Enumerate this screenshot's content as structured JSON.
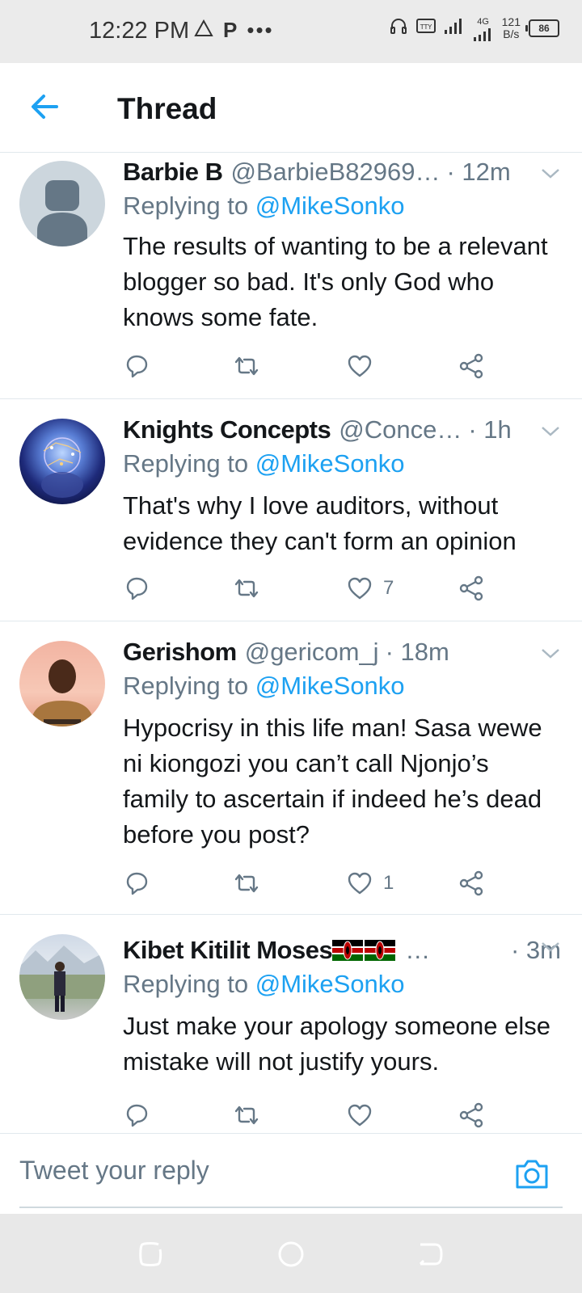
{
  "status_bar": {
    "time": "12:22 PM",
    "network_speed": "121",
    "network_speed_unit": "B/s",
    "signal_label": "4G",
    "battery": "86"
  },
  "header": {
    "title": "Thread"
  },
  "tweets": [
    {
      "name": "Barbie B",
      "handle": "@BarbieB82969…",
      "time": "· 12m",
      "replying_prefix": "Replying to",
      "mention": "@MikeSonko",
      "text": "The results of wanting to be a relevant blogger so bad. It's only God who knows some fate.",
      "likes": ""
    },
    {
      "name": "Knights Concepts",
      "handle": "@Conce…",
      "time": "· 1h",
      "replying_prefix": "Replying to",
      "mention": "@MikeSonko",
      "text": "That's why I love auditors, without evidence they can't form an opinion",
      "likes": "7"
    },
    {
      "name": "Gerishom",
      "handle": "@gericom_j",
      "time": "· 18m",
      "replying_prefix": "Replying to",
      "mention": "@MikeSonko",
      "text": "Hypocrisy in this life man! Sasa wewe ni kiongozi you can’t call Njonjo’s family to ascertain if indeed he’s dead before you post?",
      "likes": "1"
    },
    {
      "name": "Kibet Kitilit Moses",
      "handle": "…",
      "time": "· 3m",
      "replying_prefix": "Replying to",
      "mention": "@MikeSonko",
      "text": "Just make your apology someone else mistake will not justify yours.",
      "likes": ""
    }
  ],
  "reply_bar": {
    "placeholder": "Tweet your reply"
  },
  "colors": {
    "accent": "#1da1f2",
    "secondary_text": "#657786",
    "primary_text": "#14171a"
  }
}
